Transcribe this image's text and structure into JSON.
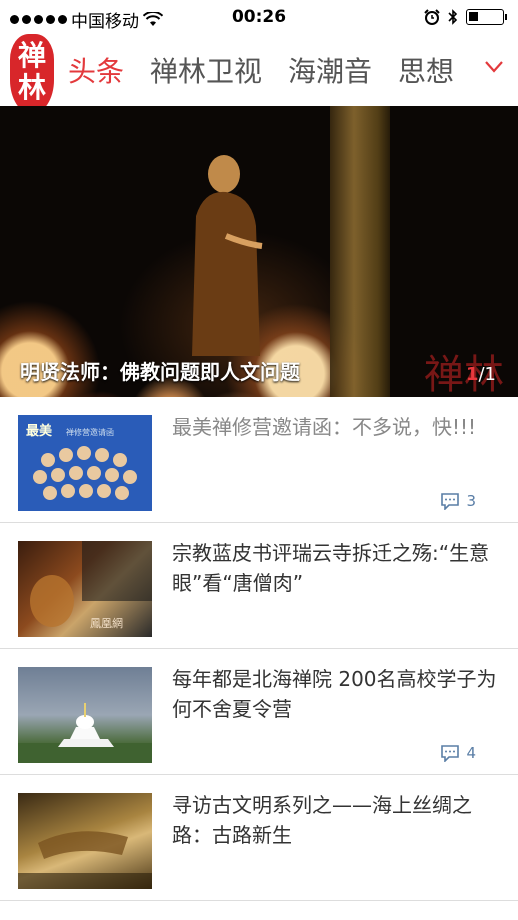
{
  "status_bar": {
    "carrier": "中国移动",
    "time": "00:26"
  },
  "app": {
    "logo_text": "禅林",
    "brand_color": "#d8262a",
    "accent_color": "#e3393c"
  },
  "nav": {
    "tabs": [
      {
        "label": "头条",
        "active": true
      },
      {
        "label": "禅林卫视",
        "active": false
      },
      {
        "label": "海潮音",
        "active": false
      },
      {
        "label": "思想",
        "active": false
      }
    ],
    "more_icon": "chevron-down-icon"
  },
  "hero": {
    "title": "明贤法师：佛教问题即人文问题",
    "watermark": "禅林",
    "pager_current": "1",
    "pager_total": "/1"
  },
  "news": [
    {
      "title": "最美禅修营邀请函：不多说，快!!!",
      "comments": "3",
      "read": true,
      "thumb_text": "最美 禅修营邀请函"
    },
    {
      "title": "宗教蓝皮书评瑞云寺拆迁之殇:“生意眼”看“唐僧肉”",
      "comments": "",
      "read": false,
      "thumb_text": "鳳凰網"
    },
    {
      "title": "每年都是北海禅院 200名高校学子为何不舍夏令营",
      "comments": "4",
      "read": false,
      "thumb_text": ""
    },
    {
      "title": "寻访古文明系列之——海上丝绸之路：古路新生",
      "comments": "",
      "read": false,
      "thumb_text": ""
    }
  ]
}
